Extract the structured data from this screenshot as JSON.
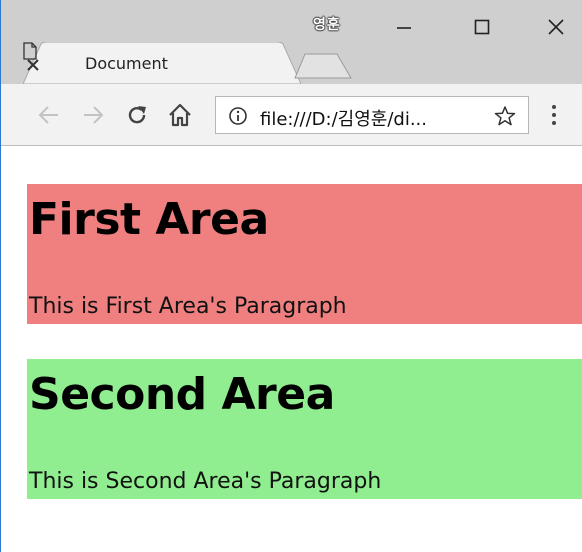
{
  "browser": {
    "profile_name": "영훈",
    "tab": {
      "title": "Document"
    },
    "address_bar": {
      "url": "file:///D:/김영훈/di..."
    }
  },
  "page": {
    "areas": [
      {
        "heading": "First Area",
        "paragraph": "This is First Area's Paragraph",
        "background": "#f08080"
      },
      {
        "heading": "Second Area",
        "paragraph": "This is Second Area's Paragraph",
        "background": "#90ee90"
      }
    ]
  },
  "colors": {
    "window_border": "#2b79d0",
    "tabstrip": "#cfcfcf",
    "toolbar": "#f2f2f2"
  },
  "icons": [
    "document-icon",
    "tab-close-icon",
    "new-tab-icon",
    "minimize-icon",
    "maximize-icon",
    "close-icon",
    "back-arrow-icon",
    "forward-arrow-icon",
    "reload-icon",
    "home-icon",
    "info-icon",
    "star-icon",
    "kebab-menu-icon"
  ]
}
